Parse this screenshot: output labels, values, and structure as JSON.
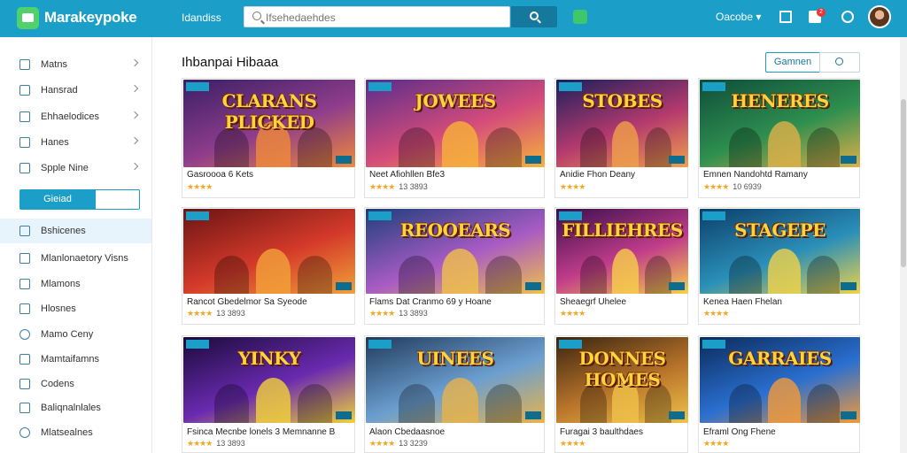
{
  "header": {
    "brand": "Marakeypoke",
    "nav_link": "Idandiss",
    "search_placeholder": "Ifsehedaehdes",
    "account_label": "Oacobe",
    "notification_count": "2"
  },
  "sidebar": {
    "top_items": [
      {
        "label": "Matns",
        "icon": "store-icon"
      },
      {
        "label": "Hansrad",
        "icon": "list-icon"
      },
      {
        "label": "Ehhaelodices",
        "icon": "grid-icon"
      },
      {
        "label": "Hanes",
        "icon": "tag-icon"
      },
      {
        "label": "Spple Nine",
        "icon": "star-icon"
      }
    ],
    "button_label": "Gieiad",
    "bottom_items": [
      {
        "label": "Bshicenes",
        "icon": "home-icon"
      },
      {
        "label": "Mlanlonaetory Visns",
        "icon": "chart-icon"
      },
      {
        "label": "Mlamons",
        "icon": "user-icon"
      },
      {
        "label": "Hlosnes",
        "icon": "box-icon"
      },
      {
        "label": "Mamo Ceny",
        "icon": "clock-icon"
      },
      {
        "label": "Mamtaifamns",
        "icon": "bag-icon"
      },
      {
        "label": "Codens",
        "icon": "code-icon"
      },
      {
        "label": "Baliqnalnlales",
        "icon": "folder-icon"
      },
      {
        "label": "Mlatsealnes",
        "icon": "settings-icon"
      }
    ]
  },
  "main": {
    "title": "Ihbanpai Hibaaa",
    "sort_label": "Gamnen"
  },
  "cards": [
    {
      "art": "CLARANS PLICKED",
      "name": "Gasroooa 6 Kets",
      "stars": "★★★★",
      "meta": ""
    },
    {
      "art": "JOWEES",
      "name": "Neet Afiohllen Bfe3",
      "stars": "★★★★",
      "meta": "13 3893"
    },
    {
      "art": "STOBES",
      "name": "Anidie Fhon Deany",
      "stars": "★★★★",
      "meta": ""
    },
    {
      "art": "HENERES",
      "name": "Emnen Nandohtd Ramany",
      "stars": "★★★★",
      "meta": "10 6939"
    },
    {
      "art": "",
      "name": "Rancot Gbedelmor Sa Syeode",
      "stars": "★★★★",
      "meta": "13 3893"
    },
    {
      "art": "REOOEARS",
      "name": "Flams Dat Cranmo 69 y Hoane",
      "stars": "★★★★",
      "meta": "13 3893"
    },
    {
      "art": "FILLIEHRES",
      "name": "Sheaegrf Uhelee",
      "stars": "★★★★",
      "meta": ""
    },
    {
      "art": "STAGEPE",
      "name": "Kenea Haen Fhelan",
      "stars": "★★★★",
      "meta": ""
    },
    {
      "art": "YINKY",
      "name": "Fsinca Mecnbe lonels 3 Memnanne B",
      "stars": "★★★★",
      "meta": "13 3893"
    },
    {
      "art": "UINEES",
      "name": "Alaon Cbedaasnoe",
      "stars": "★★★★",
      "meta": "13 3239"
    },
    {
      "art": "DONNES HOMES",
      "name": "Furagai 3 baulthdaes",
      "stars": "★★★★",
      "meta": ""
    },
    {
      "art": "GARRAIES",
      "name": "Eframl Ong Fhene",
      "stars": "★★★★",
      "meta": ""
    }
  ],
  "colors": {
    "accent": "#1b9ec7",
    "accent_dark": "#16789c",
    "star": "#f5a623"
  }
}
